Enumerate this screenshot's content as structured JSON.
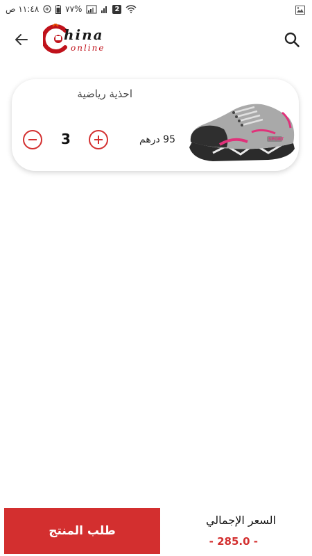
{
  "status_bar": {
    "time": "١١:٤٨ ص",
    "battery": "٧٧%",
    "sim_slot": "2"
  },
  "app_bar": {
    "logo_main": "hina",
    "logo_sub": "online",
    "back_icon": "arrow-back-icon",
    "search_icon": "search-icon"
  },
  "cart": {
    "items": [
      {
        "name": "احذية رياضية",
        "price": "95 درهم",
        "quantity": "3",
        "image_icon": "sport-shoe-image"
      }
    ]
  },
  "footer": {
    "order_button_label": "طلب المنتج",
    "total_label": "السعر الإجمالي",
    "total_value": "- 285.0 -"
  },
  "colors": {
    "accent": "#d32f2f",
    "logo_red": "#c0121b"
  }
}
